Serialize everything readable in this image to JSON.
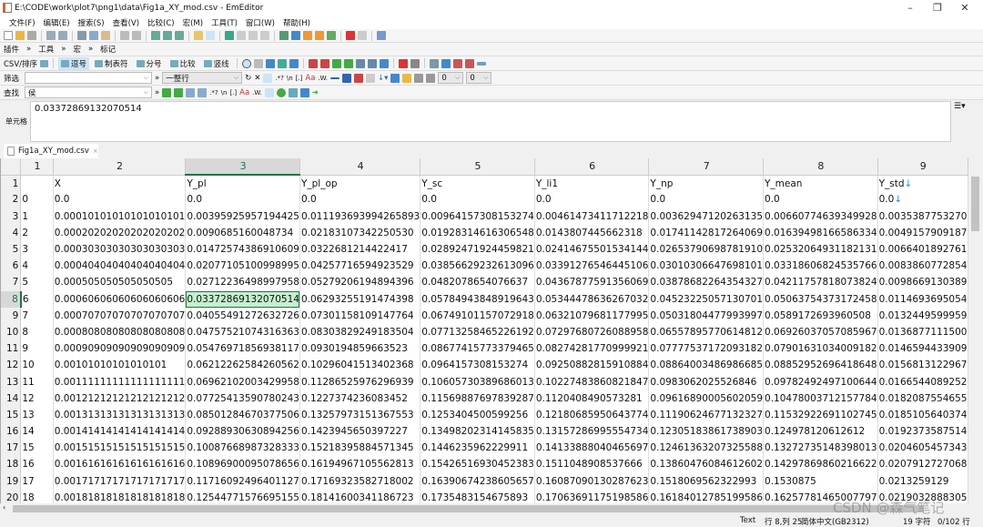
{
  "window": {
    "title": "E:\\CODE\\work\\plot7\\png1\\data\\Fig1a_XY_mod.csv - EmEditor",
    "controls": [
      "minimize",
      "restore",
      "close"
    ]
  },
  "menu": [
    "文件(F)",
    "编辑(E)",
    "搜索(S)",
    "查看(V)",
    "比较(C)",
    "宏(M)",
    "工具(T)",
    "窗口(W)",
    "帮助(H)"
  ],
  "toolbar2": {
    "plugins": "插件",
    "tools": "工具",
    "macro": "宏",
    "marks": "标记"
  },
  "csvbar": {
    "label": "CSV/排序",
    "modes": [
      {
        "label": "逗号",
        "active": true
      },
      {
        "label": "制表符",
        "active": false
      },
      {
        "label": "分号",
        "active": false
      },
      {
        "label": "比较",
        "active": false
      },
      {
        "label": "竖线",
        "active": false
      }
    ]
  },
  "filter": {
    "label": "筛选",
    "value": "",
    "scope": "一整行",
    "num1": "0",
    "num2": "0"
  },
  "find": {
    "label": "查找",
    "value": "侯"
  },
  "cell_editor": {
    "label": "单元格",
    "value": "0.03372869132070514"
  },
  "tab": {
    "name": "Fig1a_XY_mod.csv"
  },
  "grid": {
    "col_headers": [
      "1",
      "2",
      "3",
      "4",
      "5",
      "6",
      "7",
      "8",
      "9"
    ],
    "selected_col": 3,
    "selected_row": 8,
    "rows": [
      {
        "n": "1",
        "cells": [
          "",
          "X",
          "Y_pl",
          "Y_pl_op",
          "Y_sc",
          "Y_li1",
          "Y_np",
          "Y_mean",
          "Y_std"
        ]
      },
      {
        "n": "2",
        "cells": [
          "0",
          "0.0",
          "0.0",
          "0.0",
          "0.0",
          "0.0",
          "0.0",
          "0.0",
          "0.0"
        ]
      },
      {
        "n": "3",
        "cells": [
          "1",
          "0.00010101010101010101",
          "0.00395925957194425",
          "0.011193693994265893",
          "0.00964157308153274",
          "0.00461473411712218",
          "0.00362947120263135",
          "0.00660774639349928",
          "0.0035387753270"
        ]
      },
      {
        "n": "4",
        "cells": [
          "2",
          "0.00020202020202020202",
          "0.0090685160048734",
          "0.02183107342250530",
          "0.01928314616306548",
          "0.0143807445662318",
          "0.01741142817264069",
          "0.01639498166586334",
          "0.0049157909187"
        ]
      },
      {
        "n": "5",
        "cells": [
          "3",
          "0.00030303030303030303",
          "0.01472574386910609",
          "0.0322681214422417",
          "0.02892471924459821",
          "0.02414675501534144",
          "0.02653790698781910",
          "0.02532064931182131",
          "0.0066401892761"
        ]
      },
      {
        "n": "6",
        "cells": [
          "4",
          "0.00040404040404040404",
          "0.02077105100998995",
          "0.04257716594923529",
          "0.03856629232613096",
          "0.03391276546445106",
          "0.03010306647698101",
          "0.03318606824535766",
          "0.0083860772854"
        ]
      },
      {
        "n": "7",
        "cells": [
          "5",
          "0.000505050505050505",
          "0.02712236498997958",
          "0.05279206194894396",
          "0.0482078654076637",
          "0.04367877591356069",
          "0.03878682264354327",
          "0.04211757818073824",
          "0.0098669130389"
        ]
      },
      {
        "n": "8",
        "cells": [
          "6",
          "0.00060606060606060606",
          "0.03372869132070514",
          "0.06293255191474398",
          "0.05784943848919643",
          "0.05344478636267032",
          "0.04523225057130701",
          "0.05063754373172458",
          "0.0114693695054"
        ]
      },
      {
        "n": "9",
        "cells": [
          "7",
          "0.00070707070707070707",
          "0.04055491272632726",
          "0.07301158109147764",
          "0.06749101157072918",
          "0.06321079681177995",
          "0.05031804477993997",
          "0.0589172693960508",
          "0.0132449599959"
        ]
      },
      {
        "n": "10",
        "cells": [
          "8",
          "0.00080808080808080808",
          "0.04757521074316363",
          "0.08303829249183504",
          "0.07713258465226192",
          "0.07297680726088958",
          "0.06557895770614812",
          "0.06926037057085967",
          "0.0136877111500"
        ]
      },
      {
        "n": "11",
        "cells": [
          "9",
          "0.00090909090909090909",
          "0.05476971856938117",
          "0.0930194859663523",
          "0.08677415773379465",
          "0.08274281770999921",
          "0.07777537172093182",
          "0.07901631034009182",
          "0.0146594433909"
        ]
      },
      {
        "n": "12",
        "cells": [
          "10",
          "0.00101010101010101",
          "0.06212262584260562",
          "0.10296041513402368",
          "0.0964157308153274",
          "0.09250882815910884",
          "0.08864003486986685",
          "0.08852952696418648",
          "0.0156813122967"
        ]
      },
      {
        "n": "13",
        "cells": [
          "11",
          "0.00111111111111111111",
          "0.06962102003429958",
          "0.11286525976296939",
          "0.10605730389686013",
          "0.10227483860821847",
          "0.0983062025526846",
          "0.09782492497100644",
          "0.0166544089252"
        ]
      },
      {
        "n": "14",
        "cells": [
          "12",
          "0.00121212121212121212",
          "0.07725413590780243",
          "0.1227374236083452",
          "0.11569887697839287",
          "0.1120408490573281",
          "0.09616890005602059",
          "0.10478003712157784",
          "0.0182087554655"
        ]
      },
      {
        "n": "15",
        "cells": [
          "13",
          "0.00131313131313131313",
          "0.08501284670377506",
          "0.13257973151367553",
          "0.1253404500599256",
          "0.12180685950643774",
          "0.11190624677132327",
          "0.11532922691102745",
          "0.0185105640374"
        ]
      },
      {
        "n": "16",
        "cells": [
          "14",
          "0.00141414141414141414",
          "0.09288930630894256",
          "0.1423945650397227",
          "0.13498202314145835",
          "0.13157286995554734",
          "0.12305183861738903",
          "0.124978120612612",
          "0.0192373587514"
        ]
      },
      {
        "n": "17",
        "cells": [
          "15",
          "0.00151515151515151515",
          "0.10087668987328333",
          "0.15218395884571345",
          "0.1446235962229911",
          "0.14133888040465697",
          "0.12461363207325588",
          "0.13272735148398013",
          "0.0204605457343"
        ]
      },
      {
        "n": "18",
        "cells": [
          "16",
          "0.00161616161616161616",
          "0.10896900095078656",
          "0.16194967105562813",
          "0.15426516930452383",
          "0.1511048908537666",
          "0.13860476084612602",
          "0.14297869860216622",
          "0.0207912727068"
        ]
      },
      {
        "n": "19",
        "cells": [
          "17",
          "0.00171717171717171717",
          "0.11716092496401127",
          "0.17169323582718002",
          "0.16390674238605657",
          "0.16087090130287623",
          "0.1518069562322993",
          "0.1530875",
          "0.0213259129"
        ]
      },
      {
        "n": "20",
        "cells": [
          "18",
          "0.00181818181818181818",
          "0.12544771576695155",
          "0.18141600341186723",
          "0.1735483154675893",
          "0.17063691175198586",
          "0.16184012785199586",
          "0.16257781465007797",
          "0.0219032888305"
        ]
      }
    ]
  },
  "status": {
    "mode": "Text",
    "position": "行 8,列 25",
    "encoding": "简体中文(GB2312)",
    "chars": "19 字符",
    "lines": "0/102 行"
  },
  "watermark": "CSDN @森气笔记",
  "colors": {
    "accent": "#217346",
    "selected_cell": "#c6efce",
    "active_toggle": "#cce4f7"
  }
}
